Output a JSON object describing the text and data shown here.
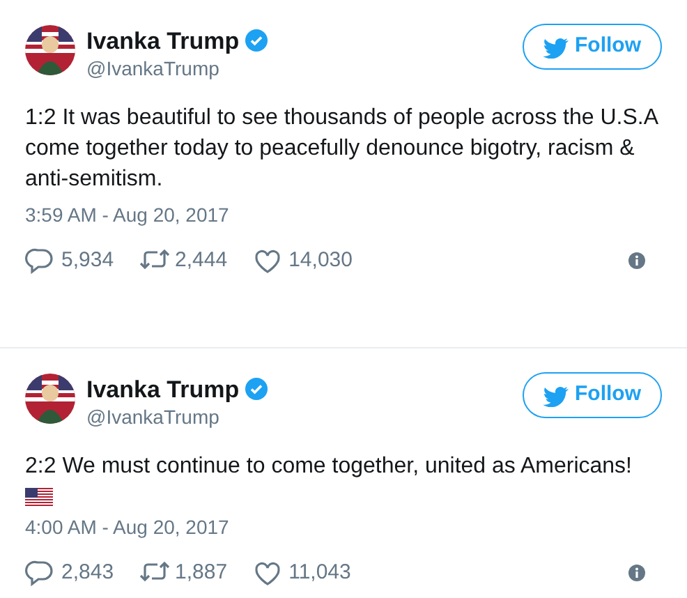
{
  "tweets": [
    {
      "name": "Ivanka Trump",
      "verified": true,
      "handle": "@IvankaTrump",
      "follow_label": "Follow",
      "text": "1:2 It was beautiful to see thousands of people across the U.S.A come together today to peacefully denounce bigotry, racism & anti-semitism.",
      "time": "3:59 AM - Aug 20, 2017",
      "replies": "5,934",
      "retweets": "2,444",
      "likes": "14,030"
    },
    {
      "name": "Ivanka Trump",
      "verified": true,
      "handle": "@IvankaTrump",
      "follow_label": "Follow",
      "text": "2:2 We must continue to come together, united as Americans!",
      "flag_emoji": true,
      "time": "4:00 AM - Aug 20, 2017",
      "replies": "2,843",
      "retweets": "1,887",
      "likes": "11,043"
    }
  ]
}
